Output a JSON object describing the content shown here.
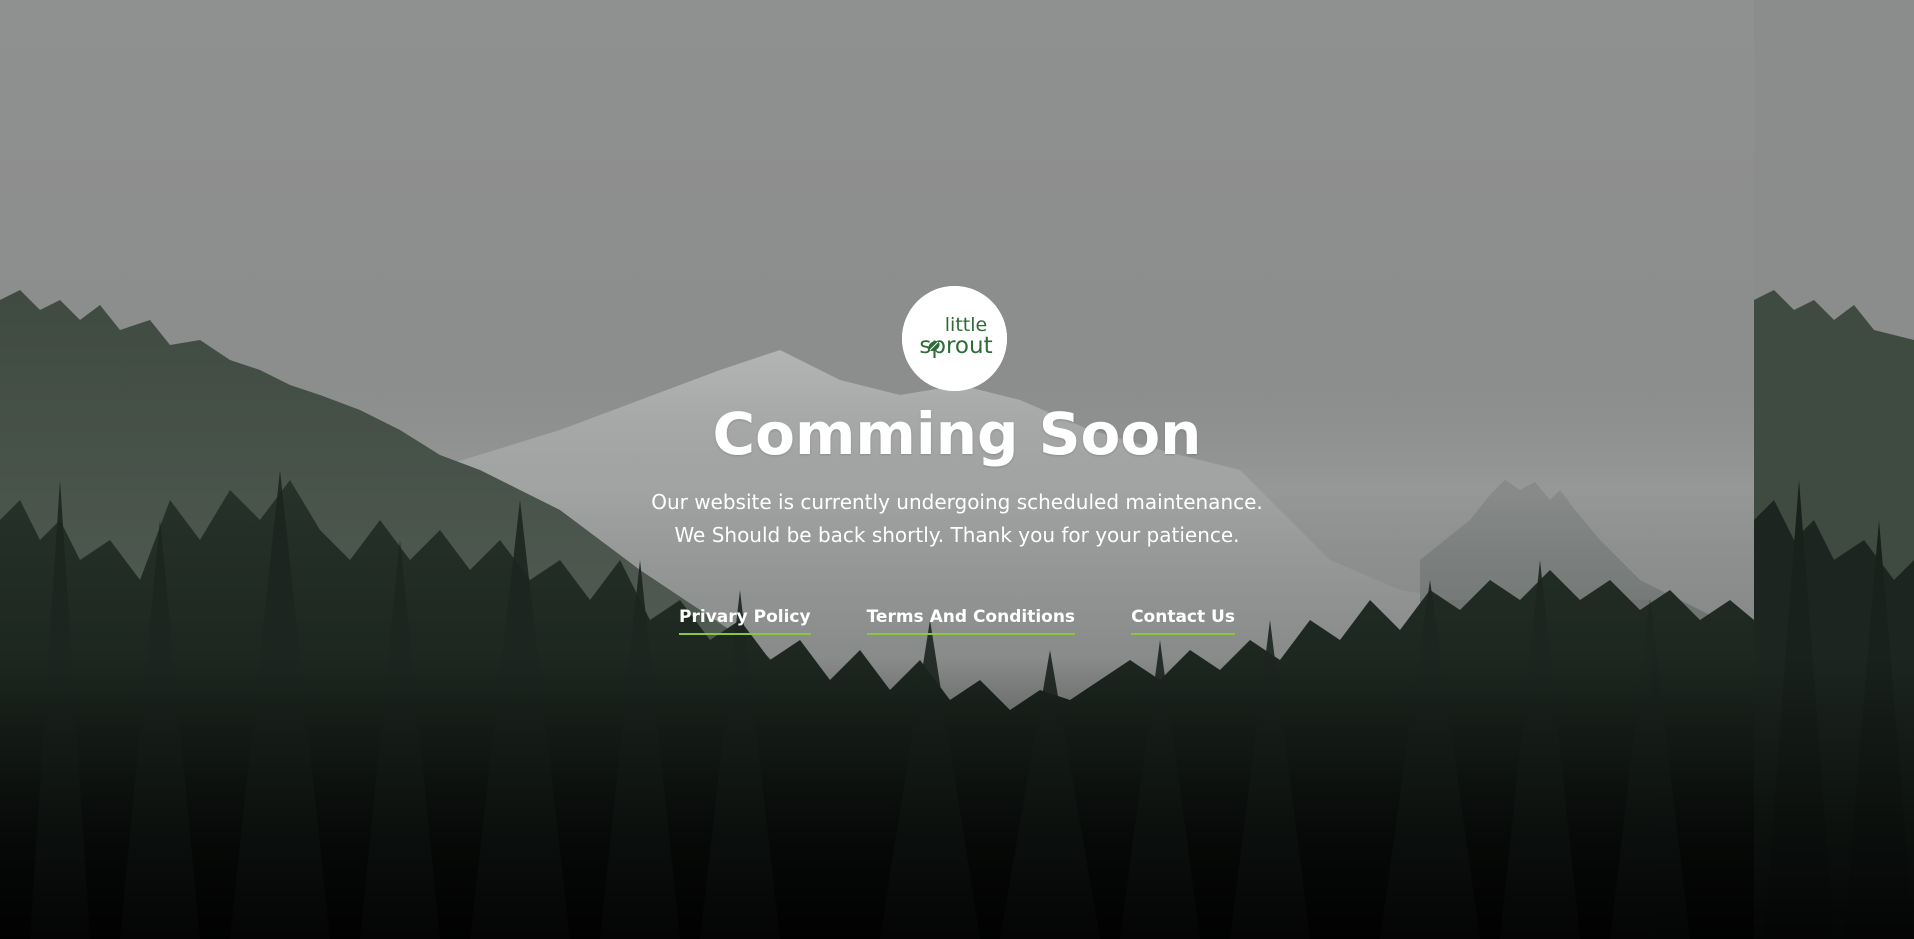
{
  "logo": {
    "line1": "little",
    "line2": "sprout",
    "accent_color": "#2e6b3a"
  },
  "heading": "Comming Soon",
  "message": {
    "line1": "Our website is currently undergoing scheduled maintenance.",
    "line2": "We Should be back shortly. Thank you for your patience."
  },
  "footer_links": [
    {
      "label": "Privary Policy"
    },
    {
      "label": "Terms And Conditions"
    },
    {
      "label": "Contact Us"
    }
  ],
  "colors": {
    "link_underline": "#8cc63f",
    "text": "#ffffff"
  }
}
